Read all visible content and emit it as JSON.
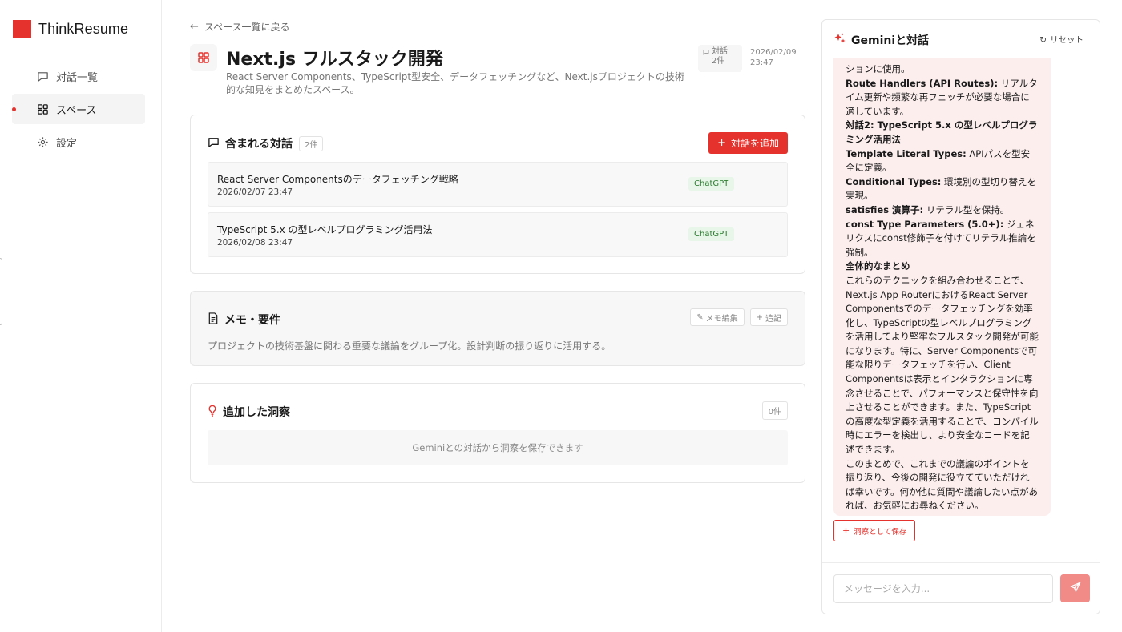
{
  "sidebar": {
    "brand": "ThinkResume",
    "items": [
      {
        "label": "対話一覧"
      },
      {
        "label": "スペース"
      },
      {
        "label": "設定"
      }
    ]
  },
  "header": {
    "back_label": "スペース一覧に戻る",
    "title": "Next.js フルスタック開発",
    "description": "React Server Components、TypeScript型安全、データフェッチングなど、Next.jsプロジェクトの技術的な知見をまとめたスペース。",
    "meta_label": "対話",
    "meta_count": "2件",
    "date": "2026/02/09",
    "time": "23:47"
  },
  "conversations": {
    "title": "含まれる対話",
    "count": "2件",
    "add_label": "対話を追加",
    "items": [
      {
        "title": "React Server Componentsのデータフェッチング戦略",
        "date": "2026/02/07 23:47",
        "tag": "ChatGPT"
      },
      {
        "title": "TypeScript 5.x の型レベルプログラミング活用法",
        "date": "2026/02/08 23:47",
        "tag": "ChatGPT"
      }
    ]
  },
  "memo": {
    "title": "メモ・要件",
    "edit_label": "メモ編集",
    "append_label": "追記",
    "text": "プロジェクトの技術基盤に関わる重要な議論をグループ化。設計判断の振り返りに活用する。"
  },
  "insights": {
    "title": "追加した洞察",
    "count": "0件",
    "empty_text": "Geminiとの対話から洞察を保存できます"
  },
  "chat": {
    "title": "Geminiと対話",
    "reset_label": "リセット",
    "message": [
      {
        "b": "",
        "t": "ションに使用。"
      },
      {
        "b": "Route Handlers (API Routes):",
        "t": " リアルタイム更新や頻繁な再フェッチが必要な場合に適しています。"
      },
      {
        "b": "対話2: TypeScript 5.x の型レベルプログラミング活用法",
        "t": ""
      },
      {
        "b": "Template Literal Types:",
        "t": " APIパスを型安全に定義。"
      },
      {
        "b": "Conditional Types:",
        "t": " 環境別の型切り替えを実現。"
      },
      {
        "b": "satisfies 演算子:",
        "t": " リテラル型を保持。"
      },
      {
        "b": "const Type Parameters (5.0+):",
        "t": " ジェネリクスにconst修飾子を付けてリテラル推論を強制。"
      },
      {
        "b": "全体的なまとめ",
        "t": ""
      },
      {
        "b": "",
        "t": "これらのテクニックを組み合わせることで、Next.js App RouterにおけるReact Server Componentsでのデータフェッチングを効率化し、TypeScriptの型レベルプログラミングを活用してより堅牢なフルスタック開発が可能になります。特に、Server Componentsで可能な限りデータフェッチを行い、Client Componentsは表示とインタラクションに専念させることで、パフォーマンスと保守性を向上させることができます。また、TypeScriptの高度な型定義を活用することで、コンパイル時にエラーを検出し、より安全なコードを記述できます。"
      },
      {
        "b": "",
        "t": "このまとめで、これまでの議論のポイントを振り返り、今後の開発に役立てていただければ幸いです。何か他に質問や議論したい点があれば、お気軽にお尋ねください。"
      }
    ],
    "save_label": "洞察として保存",
    "input_placeholder": "メッセージを入力...",
    "input_value": ""
  },
  "colors": {
    "accent": "#e5322d",
    "bubble": "#fdeeee",
    "tag_green": "#2e7d32"
  }
}
